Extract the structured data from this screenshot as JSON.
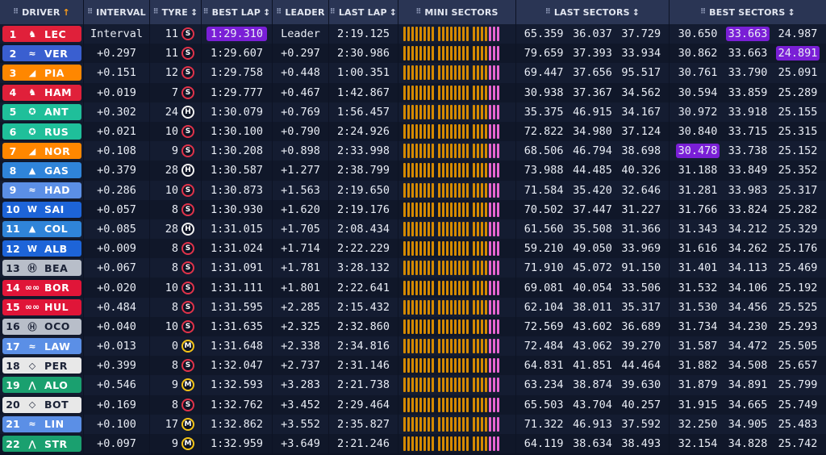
{
  "headers": {
    "driver": "DRIVER",
    "interval": "INTERVAL",
    "tyre": "TYRE",
    "best_lap": "BEST LAP",
    "leader": "LEADER",
    "last_lap": "LAST LAP",
    "mini_sectors": "MINI SECTORS",
    "last_sectors": "LAST SECTORS",
    "best_sectors": "BEST SECTORS"
  },
  "colors": {
    "ferrari": "#e0203a",
    "red_bull": "#3a5fd0",
    "mclaren": "#ff8700",
    "mercedes": "#1fbf9a",
    "alpine": "#2f84d9",
    "racing_bulls": "#5b8fe6",
    "williams": "#1d64d8",
    "haas": "#b8bec9",
    "audi": "#e01538",
    "aston_martin": "#1aa06f",
    "cadillac": "#e8e8e8",
    "fastest_purple": "#7a1fd6",
    "sector_yellow": "#d58a00",
    "sector_pink": "#e865d1"
  },
  "drivers": [
    {
      "pos": "1",
      "code": "LEC",
      "team": "ferrari",
      "logo": "prancing-horse-icon",
      "glyph": "♞",
      "interval": "Interval",
      "tyre_age": "11",
      "compound": "S",
      "best": "1:29.310",
      "best_fastest": true,
      "leader": "Leader",
      "last": "2:19.125",
      "ls": [
        "65.359",
        "36.037",
        "37.729"
      ],
      "bs": [
        "30.650",
        "33.663",
        "24.987"
      ],
      "bs_hl": [
        false,
        true,
        false
      ]
    },
    {
      "pos": "2",
      "code": "VER",
      "team": "red_bull",
      "logo": "bull-icon",
      "glyph": "≈",
      "interval": "+0.297",
      "tyre_age": "11",
      "compound": "S",
      "best": "1:29.607",
      "best_fastest": false,
      "leader": "+0.297",
      "last": "2:30.986",
      "ls": [
        "79.659",
        "37.393",
        "33.934"
      ],
      "bs": [
        "30.862",
        "33.663",
        "24.891"
      ],
      "bs_hl": [
        false,
        false,
        true
      ]
    },
    {
      "pos": "3",
      "code": "PIA",
      "team": "mclaren",
      "logo": "mclaren-icon",
      "glyph": "◢",
      "interval": "+0.151",
      "tyre_age": "12",
      "compound": "S",
      "best": "1:29.758",
      "best_fastest": false,
      "leader": "+0.448",
      "last": "1:00.351",
      "ls": [
        "69.447",
        "37.656",
        "95.517"
      ],
      "bs": [
        "30.761",
        "33.790",
        "25.091"
      ],
      "bs_hl": [
        false,
        false,
        false
      ]
    },
    {
      "pos": "4",
      "code": "HAM",
      "team": "ferrari",
      "logo": "prancing-horse-icon",
      "glyph": "♞",
      "interval": "+0.019",
      "tyre_age": "7",
      "compound": "S",
      "best": "1:29.777",
      "best_fastest": false,
      "leader": "+0.467",
      "last": "1:42.867",
      "ls": [
        "30.938",
        "37.367",
        "34.562"
      ],
      "bs": [
        "30.594",
        "33.859",
        "25.289"
      ],
      "bs_hl": [
        false,
        false,
        false
      ]
    },
    {
      "pos": "5",
      "code": "ANT",
      "team": "mercedes",
      "logo": "mercedes-star-icon",
      "glyph": "✪",
      "interval": "+0.302",
      "tyre_age": "24",
      "compound": "H",
      "best": "1:30.079",
      "best_fastest": false,
      "leader": "+0.769",
      "last": "1:56.457",
      "ls": [
        "35.375",
        "46.915",
        "34.167"
      ],
      "bs": [
        "30.972",
        "33.918",
        "25.155"
      ],
      "bs_hl": [
        false,
        false,
        false
      ]
    },
    {
      "pos": "6",
      "code": "RUS",
      "team": "mercedes",
      "logo": "mercedes-star-icon",
      "glyph": "✪",
      "interval": "+0.021",
      "tyre_age": "10",
      "compound": "S",
      "best": "1:30.100",
      "best_fastest": false,
      "leader": "+0.790",
      "last": "2:24.926",
      "ls": [
        "72.822",
        "34.980",
        "37.124"
      ],
      "bs": [
        "30.840",
        "33.715",
        "25.315"
      ],
      "bs_hl": [
        false,
        false,
        false
      ]
    },
    {
      "pos": "7",
      "code": "NOR",
      "team": "mclaren",
      "logo": "mclaren-icon",
      "glyph": "◢",
      "interval": "+0.108",
      "tyre_age": "9",
      "compound": "S",
      "best": "1:30.208",
      "best_fastest": false,
      "leader": "+0.898",
      "last": "2:33.998",
      "ls": [
        "68.506",
        "46.794",
        "38.698"
      ],
      "bs": [
        "30.478",
        "33.738",
        "25.152"
      ],
      "bs_hl": [
        true,
        false,
        false
      ]
    },
    {
      "pos": "8",
      "code": "GAS",
      "team": "alpine",
      "logo": "alpine-icon",
      "glyph": "▲",
      "interval": "+0.379",
      "tyre_age": "28",
      "compound": "H",
      "best": "1:30.587",
      "best_fastest": false,
      "leader": "+1.277",
      "last": "2:38.799",
      "ls": [
        "73.988",
        "44.485",
        "40.326"
      ],
      "bs": [
        "31.188",
        "33.849",
        "25.352"
      ],
      "bs_hl": [
        false,
        false,
        false
      ]
    },
    {
      "pos": "9",
      "code": "HAD",
      "team": "racing_bulls",
      "logo": "bull-icon",
      "glyph": "≈",
      "interval": "+0.286",
      "tyre_age": "10",
      "compound": "S",
      "best": "1:30.873",
      "best_fastest": false,
      "leader": "+1.563",
      "last": "2:19.650",
      "ls": [
        "71.584",
        "35.420",
        "32.646"
      ],
      "bs": [
        "31.281",
        "33.983",
        "25.317"
      ],
      "bs_hl": [
        false,
        false,
        false
      ]
    },
    {
      "pos": "10",
      "code": "SAI",
      "team": "williams",
      "logo": "williams-icon",
      "glyph": "W",
      "interval": "+0.057",
      "tyre_age": "8",
      "compound": "S",
      "best": "1:30.930",
      "best_fastest": false,
      "leader": "+1.620",
      "last": "2:19.176",
      "ls": [
        "70.502",
        "37.447",
        "31.227"
      ],
      "bs": [
        "31.766",
        "33.824",
        "25.282"
      ],
      "bs_hl": [
        false,
        false,
        false
      ]
    },
    {
      "pos": "11",
      "code": "COL",
      "team": "alpine",
      "logo": "alpine-icon",
      "glyph": "▲",
      "interval": "+0.085",
      "tyre_age": "28",
      "compound": "H",
      "best": "1:31.015",
      "best_fastest": false,
      "leader": "+1.705",
      "last": "2:08.434",
      "ls": [
        "61.560",
        "35.508",
        "31.366"
      ],
      "bs": [
        "31.343",
        "34.212",
        "25.329"
      ],
      "bs_hl": [
        false,
        false,
        false
      ]
    },
    {
      "pos": "12",
      "code": "ALB",
      "team": "williams",
      "logo": "williams-icon",
      "glyph": "W",
      "interval": "+0.009",
      "tyre_age": "8",
      "compound": "S",
      "best": "1:31.024",
      "best_fastest": false,
      "leader": "+1.714",
      "last": "2:22.229",
      "ls": [
        "59.210",
        "49.050",
        "33.969"
      ],
      "bs": [
        "31.616",
        "34.262",
        "25.176"
      ],
      "bs_hl": [
        false,
        false,
        false
      ]
    },
    {
      "pos": "13",
      "code": "BEA",
      "team": "haas",
      "logo": "haas-icon",
      "glyph": "Ⓗ",
      "interval": "+0.067",
      "tyre_age": "8",
      "compound": "S",
      "best": "1:31.091",
      "best_fastest": false,
      "leader": "+1.781",
      "last": "3:28.132",
      "ls": [
        "71.910",
        "45.072",
        "91.150"
      ],
      "bs": [
        "31.401",
        "34.113",
        "25.469"
      ],
      "bs_hl": [
        false,
        false,
        false
      ]
    },
    {
      "pos": "14",
      "code": "BOR",
      "team": "audi",
      "logo": "audi-rings-icon",
      "glyph": "∞∞",
      "interval": "+0.020",
      "tyre_age": "10",
      "compound": "S",
      "best": "1:31.111",
      "best_fastest": false,
      "leader": "+1.801",
      "last": "2:22.641",
      "ls": [
        "69.081",
        "40.054",
        "33.506"
      ],
      "bs": [
        "31.532",
        "34.106",
        "25.192"
      ],
      "bs_hl": [
        false,
        false,
        false
      ]
    },
    {
      "pos": "15",
      "code": "HUL",
      "team": "audi",
      "logo": "audi-rings-icon",
      "glyph": "∞∞",
      "interval": "+0.484",
      "tyre_age": "8",
      "compound": "S",
      "best": "1:31.595",
      "best_fastest": false,
      "leader": "+2.285",
      "last": "2:15.432",
      "ls": [
        "62.104",
        "38.011",
        "35.317"
      ],
      "bs": [
        "31.530",
        "34.456",
        "25.525"
      ],
      "bs_hl": [
        false,
        false,
        false
      ]
    },
    {
      "pos": "16",
      "code": "OCO",
      "team": "haas",
      "logo": "haas-icon",
      "glyph": "Ⓗ",
      "interval": "+0.040",
      "tyre_age": "10",
      "compound": "S",
      "best": "1:31.635",
      "best_fastest": false,
      "leader": "+2.325",
      "last": "2:32.860",
      "ls": [
        "72.569",
        "43.602",
        "36.689"
      ],
      "bs": [
        "31.734",
        "34.230",
        "25.293"
      ],
      "bs_hl": [
        false,
        false,
        false
      ]
    },
    {
      "pos": "17",
      "code": "LAW",
      "team": "racing_bulls",
      "logo": "bull-icon",
      "glyph": "≈",
      "interval": "+0.013",
      "tyre_age": "0",
      "compound": "M",
      "best": "1:31.648",
      "best_fastest": false,
      "leader": "+2.338",
      "last": "2:34.816",
      "ls": [
        "72.484",
        "43.062",
        "39.270"
      ],
      "bs": [
        "31.587",
        "34.472",
        "25.505"
      ],
      "bs_hl": [
        false,
        false,
        false
      ]
    },
    {
      "pos": "18",
      "code": "PER",
      "team": "cadillac",
      "logo": "cadillac-icon",
      "glyph": "◇",
      "interval": "+0.399",
      "tyre_age": "8",
      "compound": "S",
      "best": "1:32.047",
      "best_fastest": false,
      "leader": "+2.737",
      "last": "2:31.146",
      "ls": [
        "64.831",
        "41.851",
        "44.464"
      ],
      "bs": [
        "31.882",
        "34.508",
        "25.657"
      ],
      "bs_hl": [
        false,
        false,
        false
      ]
    },
    {
      "pos": "19",
      "code": "ALO",
      "team": "aston_martin",
      "logo": "aston-wings-icon",
      "glyph": "⋀",
      "interval": "+0.546",
      "tyre_age": "9",
      "compound": "M",
      "best": "1:32.593",
      "best_fastest": false,
      "leader": "+3.283",
      "last": "2:21.738",
      "ls": [
        "63.234",
        "38.874",
        "39.630"
      ],
      "bs": [
        "31.879",
        "34.891",
        "25.799"
      ],
      "bs_hl": [
        false,
        false,
        false
      ]
    },
    {
      "pos": "20",
      "code": "BOT",
      "team": "cadillac",
      "logo": "cadillac-icon",
      "glyph": "◇",
      "interval": "+0.169",
      "tyre_age": "8",
      "compound": "S",
      "best": "1:32.762",
      "best_fastest": false,
      "leader": "+3.452",
      "last": "2:29.464",
      "ls": [
        "65.503",
        "43.704",
        "40.257"
      ],
      "bs": [
        "31.915",
        "34.665",
        "25.749"
      ],
      "bs_hl": [
        false,
        false,
        false
      ]
    },
    {
      "pos": "21",
      "code": "LIN",
      "team": "racing_bulls",
      "logo": "bull-icon",
      "glyph": "≈",
      "interval": "+0.100",
      "tyre_age": "17",
      "compound": "M",
      "best": "1:32.862",
      "best_fastest": false,
      "leader": "+3.552",
      "last": "2:35.827",
      "ls": [
        "71.322",
        "46.913",
        "37.592"
      ],
      "bs": [
        "32.250",
        "34.905",
        "25.483"
      ],
      "bs_hl": [
        false,
        false,
        false
      ]
    },
    {
      "pos": "22",
      "code": "STR",
      "team": "aston_martin",
      "logo": "aston-wings-icon",
      "glyph": "⋀",
      "interval": "+0.097",
      "tyre_age": "9",
      "compound": "M",
      "best": "1:32.959",
      "best_fastest": false,
      "leader": "+3.649",
      "last": "2:21.246",
      "ls": [
        "64.119",
        "38.634",
        "38.493"
      ],
      "bs": [
        "32.154",
        "34.828",
        "25.742"
      ],
      "bs_hl": [
        false,
        false,
        false
      ]
    }
  ]
}
